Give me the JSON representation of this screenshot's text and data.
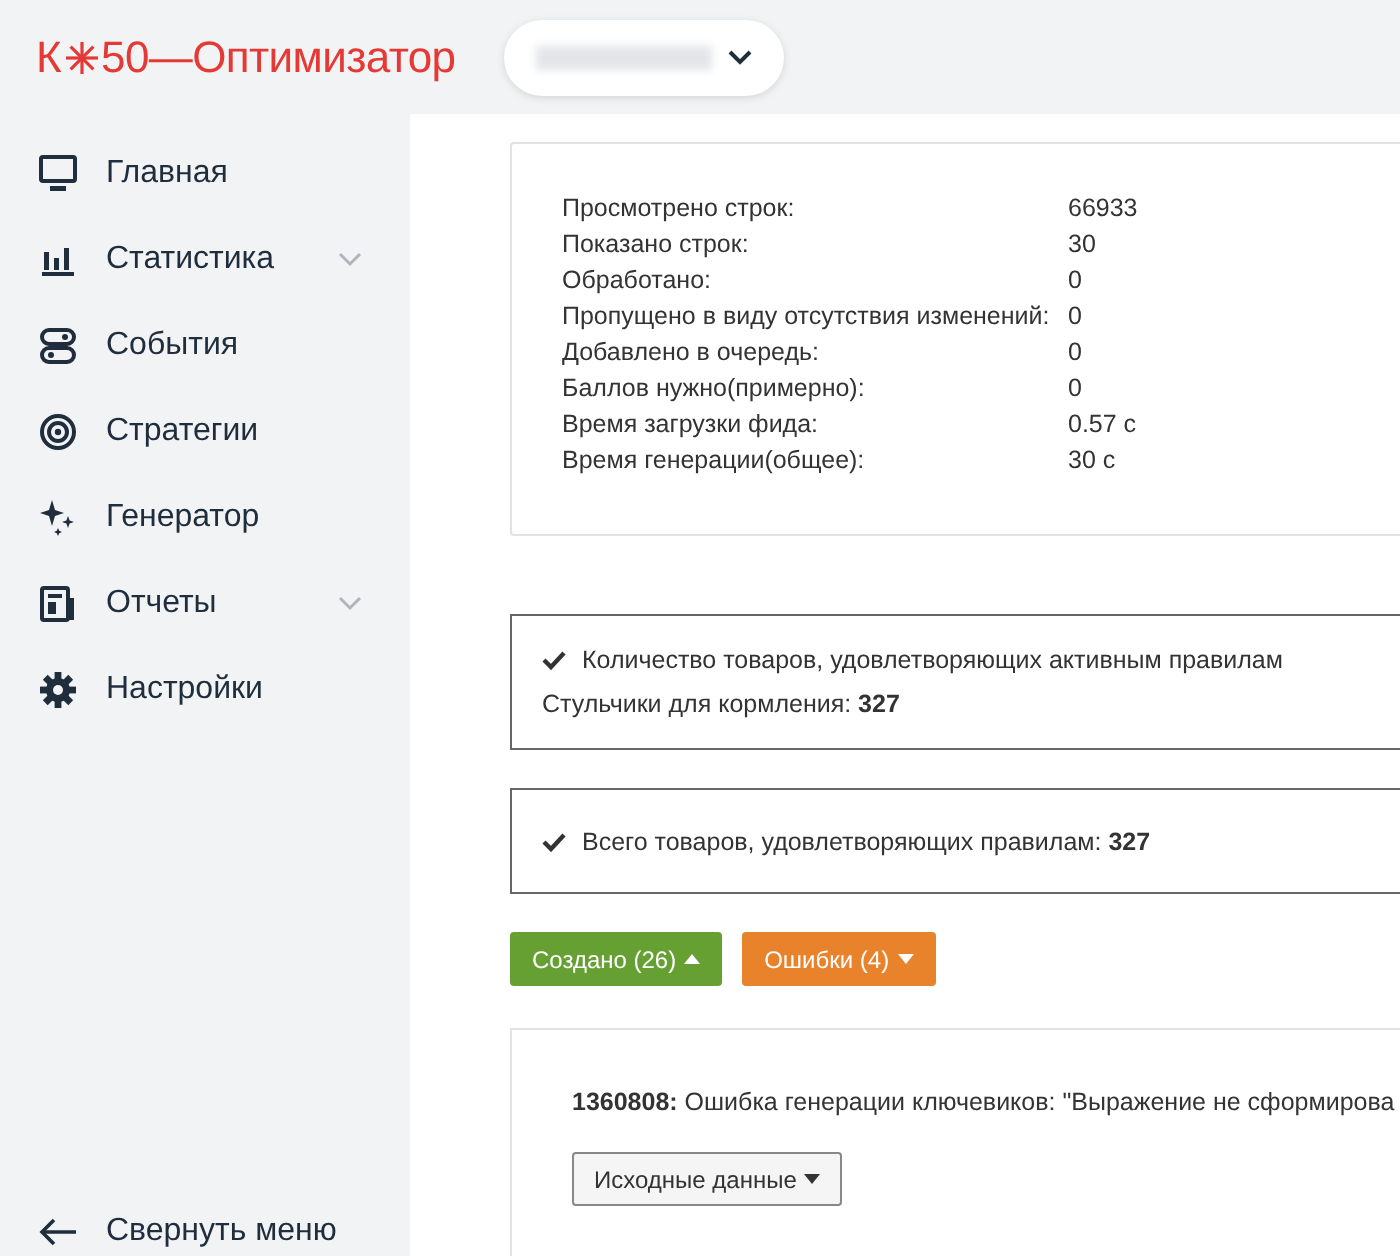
{
  "logo": {
    "prefix": "К",
    "suffix": "50—Оптимизатор"
  },
  "project_selector": {
    "expanded": false
  },
  "sidebar": {
    "items": [
      {
        "label": "Главная",
        "has_submenu": false
      },
      {
        "label": "Статистика",
        "has_submenu": true
      },
      {
        "label": "События",
        "has_submenu": false
      },
      {
        "label": "Стратегии",
        "has_submenu": false
      },
      {
        "label": "Генератор",
        "has_submenu": false
      },
      {
        "label": "Отчеты",
        "has_submenu": true
      },
      {
        "label": "Настройки",
        "has_submenu": false
      }
    ],
    "collapse_label": "Свернуть меню"
  },
  "stats": [
    {
      "label": "Просмотрено строк:",
      "value": "66933"
    },
    {
      "label": "Показано строк:",
      "value": "30"
    },
    {
      "label": "Обработано:",
      "value": "0"
    },
    {
      "label": "Пропущено в виду отсутствия изменений:",
      "value": "0"
    },
    {
      "label": "Добавлено в очередь:",
      "value": "0"
    },
    {
      "label": "Баллов нужно(примерно):",
      "value": "0"
    },
    {
      "label": "Время загрузки фида:",
      "value": "0.57 с"
    },
    {
      "label": "Время генерации(общее):",
      "value": "30 с"
    }
  ],
  "notices": [
    {
      "lines": [
        "Количество товаров, удовлетворяющих активным правилам",
        "Стульчики для кормления: **327**"
      ]
    },
    {
      "lines": [
        "Всего товаров, удовлетворяющих правилам: **327**"
      ]
    }
  ],
  "result_buttons": [
    {
      "label": "Создано (26)",
      "kind": "success",
      "expanded": true
    },
    {
      "label": "Ошибки (4)",
      "kind": "warning",
      "expanded": false
    }
  ],
  "errors": [
    {
      "message": "**1360808:** Ошибка генерации ключевиков: \"Выражение не сформирова",
      "details_button": "Исходные данные"
    }
  ]
}
